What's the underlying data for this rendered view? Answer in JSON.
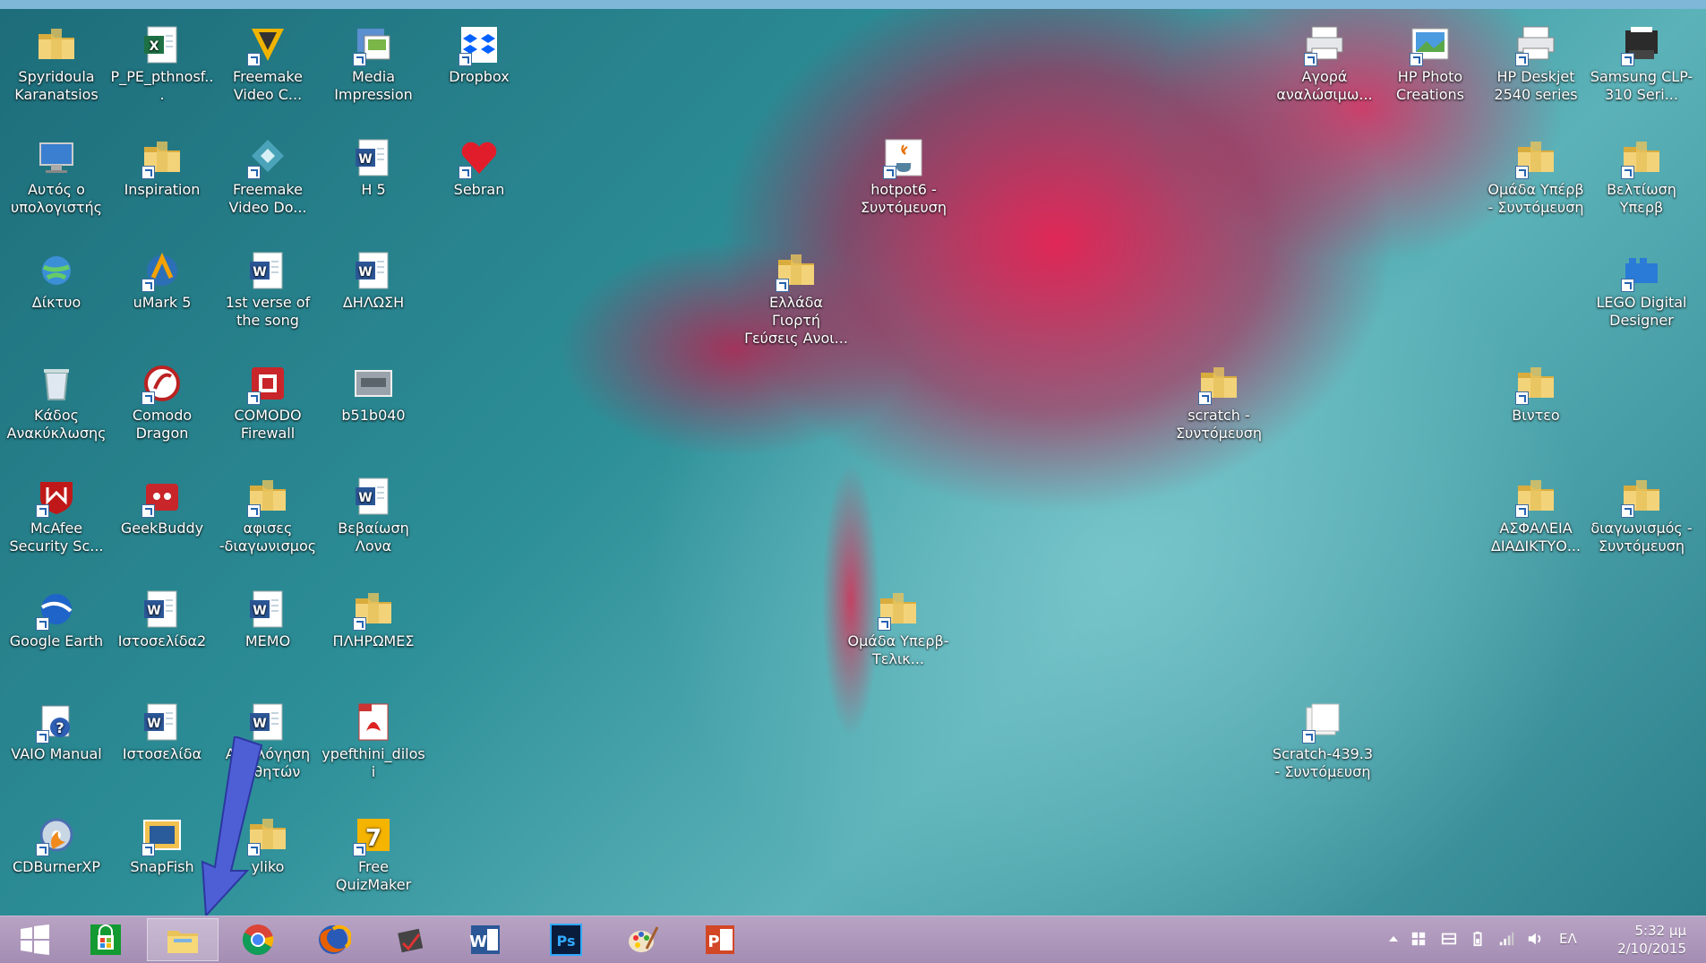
{
  "desktop": {
    "icons": [
      {
        "label": "Spyridoula Karanatsios",
        "icon": "folder-user-icon"
      },
      {
        "label": "P_PE_pthnosf...",
        "icon": "excel-file-icon"
      },
      {
        "label": "Freemake Video C...",
        "icon": "freemake-converter-icon"
      },
      {
        "label": "Media Impression",
        "icon": "media-impression-icon"
      },
      {
        "label": "Dropbox",
        "icon": "dropbox-icon"
      },
      {
        "label": "Αυτός ο υπολογιστής",
        "icon": "computer-icon"
      },
      {
        "label": "Inspiration",
        "icon": "folder-icon"
      },
      {
        "label": "Freemake Video Do...",
        "icon": "freemake-downloader-icon"
      },
      {
        "label": "Η 5",
        "icon": "word-file-icon"
      },
      {
        "label": "Sebran",
        "icon": "heart-icon"
      },
      {
        "label": "Δίκτυο",
        "icon": "network-icon"
      },
      {
        "label": "uMark 5",
        "icon": "umark-icon"
      },
      {
        "label": "1st verse of the song",
        "icon": "word-file-icon"
      },
      {
        "label": "ΔΗΛΩΣΗ",
        "icon": "word-file-icon"
      },
      {
        "label": "Κάδος Ανακύκλωσης",
        "icon": "recycle-bin-icon"
      },
      {
        "label": "Comodo Dragon",
        "icon": "comodo-dragon-icon"
      },
      {
        "label": "COMODO Firewall",
        "icon": "comodo-firewall-icon"
      },
      {
        "label": "b51b040",
        "icon": "image-file-icon"
      },
      {
        "label": "McAfee Security Sc...",
        "icon": "mcafee-icon"
      },
      {
        "label": "GeekBuddy",
        "icon": "geekbuddy-icon"
      },
      {
        "label": "αφισες -διαγωνισμος",
        "icon": "folder-icon"
      },
      {
        "label": "Βεβαίωση Λονα",
        "icon": "word-file-icon"
      },
      {
        "label": "Google Earth",
        "icon": "google-earth-icon"
      },
      {
        "label": "Ιστοσελίδα2",
        "icon": "word-file-icon"
      },
      {
        "label": "MEMO",
        "icon": "word-file-icon"
      },
      {
        "label": "ΠΛΗΡΩΜΕΣ",
        "icon": "folder-icon"
      },
      {
        "label": "VAIO Manual",
        "icon": "help-icon"
      },
      {
        "label": "Ιστοσελίδα",
        "icon": "word-file-icon"
      },
      {
        "label": "Αξιολόγηση μαθητών",
        "icon": "word-file-icon"
      },
      {
        "label": "ypefthini_dilosi",
        "icon": "pdf-file-icon"
      },
      {
        "label": "CDBurnerXP",
        "icon": "cdburner-icon"
      },
      {
        "label": "SnapFish",
        "icon": "snapfish-icon"
      },
      {
        "label": "yliko",
        "icon": "folder-icon"
      },
      {
        "label": "Free QuizMaker",
        "icon": "quizmaker-icon"
      },
      {
        "label": "hotpot6 - Συντόμευση",
        "icon": "java-icon"
      },
      {
        "label": "Ελλάδα Γιορτή Γεύσεις Ανοι...",
        "icon": "folder-icon"
      },
      {
        "label": "Ομάδα Υπερβ- Τελικ...",
        "icon": "folder-icon"
      },
      {
        "label": "scratch - Συντόμευση",
        "icon": "folder-icon"
      },
      {
        "label": "Scratch-439.3 - Συντόμευση",
        "icon": "scratch-file-icon"
      },
      {
        "label": "Αγορά αναλώσιμω...",
        "icon": "printer-icon"
      },
      {
        "label": "HP Photo Creations",
        "icon": "hp-photo-icon"
      },
      {
        "label": "HP Deskjet 2540 series",
        "icon": "printer-icon"
      },
      {
        "label": "Samsung CLP-310 Seri...",
        "icon": "printer-black-icon"
      },
      {
        "label": "Ομάδα Υπέρβ - Συντόμευση",
        "icon": "folder-icon"
      },
      {
        "label": "Βελτίωση Υπερβ",
        "icon": "folder-icon"
      },
      {
        "label": "LEGO Digital Designer",
        "icon": "lego-icon"
      },
      {
        "label": "Βιντεο",
        "icon": "folder-icon"
      },
      {
        "label": "ΑΣΦΑΛΕΙΑ ΔΙΑΔΙΚΤΥΟ...",
        "icon": "folder-icon"
      },
      {
        "label": "διαγωνισμός - Συντόμευση",
        "icon": "folder-icon"
      }
    ]
  },
  "taskbar": {
    "items": [
      {
        "name": "start-button",
        "icon": "windows-logo-icon"
      },
      {
        "name": "store-button",
        "icon": "store-icon"
      },
      {
        "name": "file-explorer-button",
        "icon": "folder-icon",
        "active": true
      },
      {
        "name": "chrome-button",
        "icon": "chrome-icon"
      },
      {
        "name": "firefox-button",
        "icon": "firefox-icon"
      },
      {
        "name": "snipping-tool-button",
        "icon": "snipping-icon"
      },
      {
        "name": "word-button",
        "icon": "word-icon"
      },
      {
        "name": "photoshop-button",
        "icon": "photoshop-icon"
      },
      {
        "name": "paint-button",
        "icon": "paint-icon"
      },
      {
        "name": "powerpoint-button",
        "icon": "powerpoint-icon"
      }
    ],
    "photoshop_label": "Ps",
    "word_label": "W",
    "powerpoint_label": "P",
    "tray": {
      "language": "ΕΛ",
      "time": "5:32 μμ",
      "date": "2/10/2015"
    }
  },
  "colors": {
    "accent": "#2563b0",
    "taskbar": "#a48db3",
    "arrow": "#4e5fd6"
  }
}
